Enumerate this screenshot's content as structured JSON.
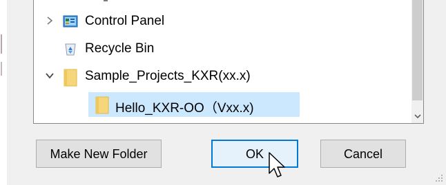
{
  "tree": {
    "items": [
      {
        "label": "Control Panel",
        "expander": "collapsed",
        "icon": "control-panel-icon"
      },
      {
        "label": "Recycle Bin",
        "expander": "none",
        "icon": "recycle-bin-icon"
      },
      {
        "label": "Sample_Projects_KXR(xx.x)",
        "expander": "expanded",
        "icon": "folder-icon"
      },
      {
        "label": "Hello_KXR-OO（Vxx.x)",
        "expander": "none",
        "icon": "folder-icon",
        "selected": true
      }
    ]
  },
  "buttons": {
    "make_new_folder": "Make New Folder",
    "ok": "OK",
    "cancel": "Cancel"
  },
  "colors": {
    "selection": "#cce8ff",
    "ok_border": "#0078d7",
    "folder": "#f6d67a"
  }
}
